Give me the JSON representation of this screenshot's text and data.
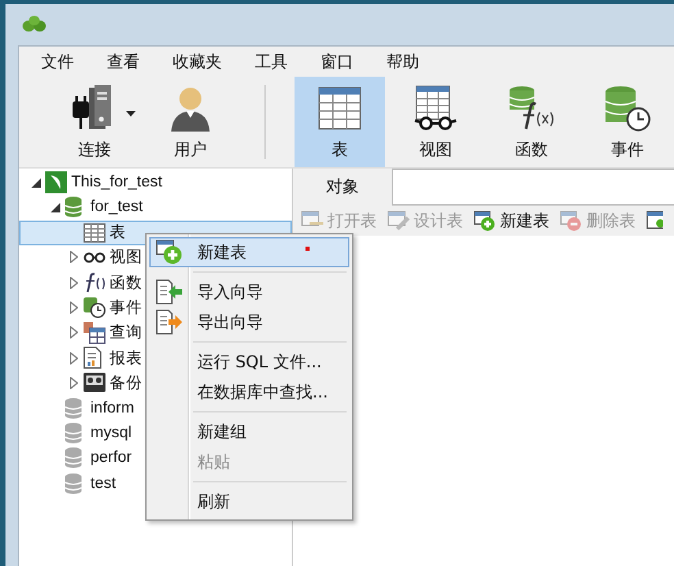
{
  "menu_bar": [
    {
      "label": "文件"
    },
    {
      "label": "查看"
    },
    {
      "label": "收藏夹"
    },
    {
      "label": "工具"
    },
    {
      "label": "窗口"
    },
    {
      "label": "帮助"
    }
  ],
  "toolbar": [
    {
      "label": "连接",
      "kind": "connect",
      "selected": false
    },
    {
      "label": "用户",
      "kind": "user",
      "selected": false
    },
    {
      "kind": "separator"
    },
    {
      "label": "表",
      "kind": "table",
      "selected": true
    },
    {
      "label": "视图",
      "kind": "view",
      "selected": false
    },
    {
      "label": "函数",
      "kind": "function",
      "selected": false
    },
    {
      "label": "事件",
      "kind": "event",
      "selected": false
    }
  ],
  "tree": [
    {
      "label": "This_for_test",
      "kind": "connection",
      "selected": false,
      "expanded": true,
      "children": [
        {
          "label": "for_test",
          "kind": "database-open",
          "selected": false,
          "expanded": true,
          "children": [
            {
              "label": "表",
              "kind": "tables",
              "selected": true
            },
            {
              "label": "视图",
              "kind": "views",
              "selected": false,
              "expanded": false
            },
            {
              "label": "函数",
              "kind": "functions",
              "selected": false,
              "expanded": false
            },
            {
              "label": "事件",
              "kind": "events",
              "selected": false,
              "expanded": false
            },
            {
              "label": "查询",
              "kind": "queries",
              "selected": false,
              "expanded": false
            },
            {
              "label": "报表",
              "kind": "reports",
              "selected": false,
              "expanded": false
            },
            {
              "label": "备份",
              "kind": "backups",
              "selected": false,
              "expanded": false
            }
          ]
        },
        {
          "label": "inform",
          "kind": "database",
          "selected": false
        },
        {
          "label": "mysql",
          "kind": "database",
          "selected": false
        },
        {
          "label": "perfor",
          "kind": "database",
          "selected": false
        },
        {
          "label": "test",
          "kind": "database",
          "selected": false
        }
      ]
    }
  ],
  "tabs": [
    {
      "label": "对象",
      "selected": true
    }
  ],
  "object_toolbar": [
    {
      "label": "打开表",
      "kind": "open",
      "disabled": true
    },
    {
      "label": "设计表",
      "kind": "design",
      "disabled": true
    },
    {
      "label": "新建表",
      "kind": "new",
      "disabled": false
    },
    {
      "label": "删除表",
      "kind": "delete",
      "disabled": true
    }
  ],
  "context_menu": [
    {
      "kind": "new",
      "label": "新建表",
      "selected": true,
      "disabled": false
    },
    {
      "kind": "separator"
    },
    {
      "kind": "import",
      "label": "导入向导",
      "selected": false,
      "disabled": false
    },
    {
      "kind": "export",
      "label": "导出向导",
      "selected": false,
      "disabled": false
    },
    {
      "kind": "separator"
    },
    {
      "kind": "plain",
      "label": "运行 SQL 文件...",
      "selected": false,
      "disabled": false
    },
    {
      "kind": "plain",
      "label": "在数据库中查找...",
      "selected": false,
      "disabled": false
    },
    {
      "kind": "separator"
    },
    {
      "kind": "plain",
      "label": "新建组",
      "selected": false,
      "disabled": false
    },
    {
      "kind": "plain",
      "label": "粘贴",
      "selected": false,
      "disabled": true
    },
    {
      "kind": "separator"
    },
    {
      "kind": "plain",
      "label": "刷新",
      "selected": false,
      "disabled": false
    }
  ]
}
